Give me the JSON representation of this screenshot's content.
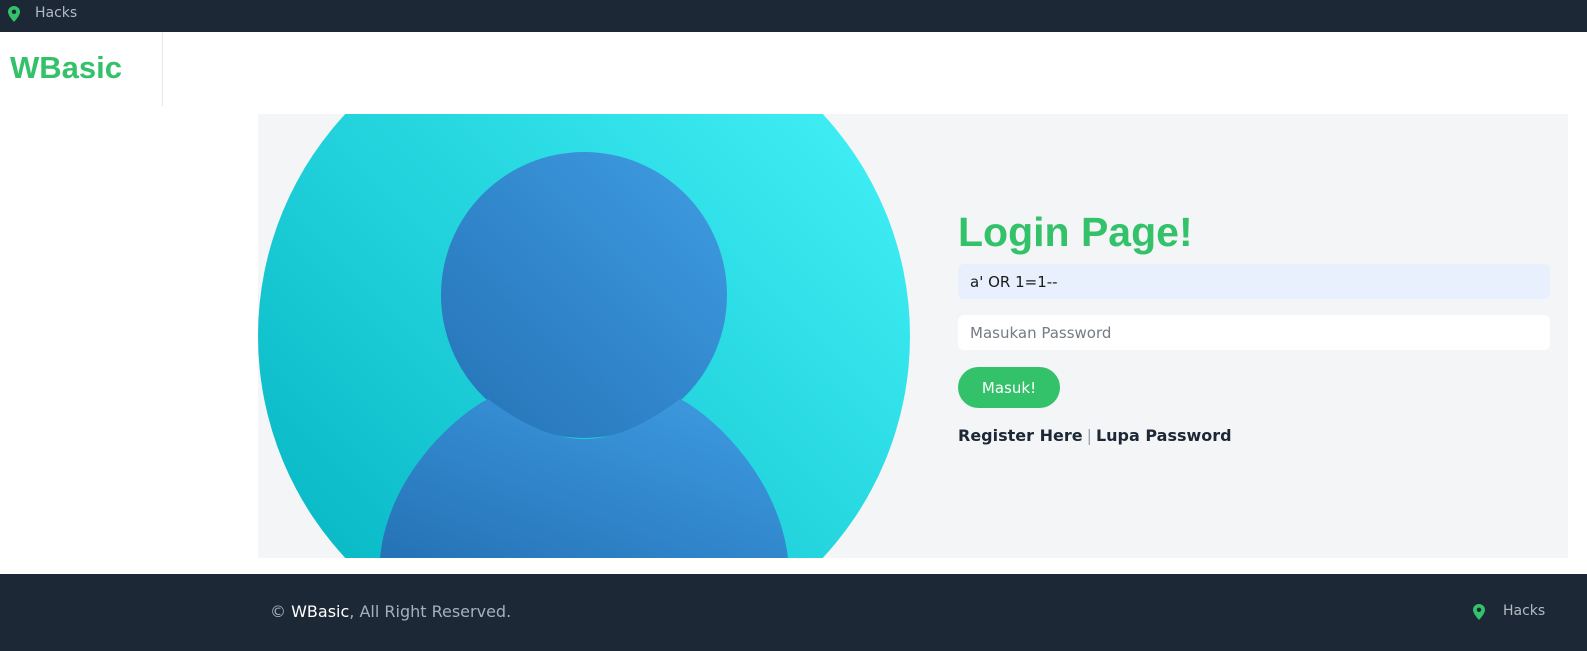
{
  "topbar": {
    "location_label": "Hacks",
    "icon": "map-pin-icon"
  },
  "header": {
    "brand": "WBasic"
  },
  "login": {
    "title": "Login Page!",
    "username_value": "a' OR 1=1--",
    "password_placeholder": "Masukan Password",
    "submit_label": "Masuk!",
    "register_link": "Register Here",
    "separator": "|",
    "forgot_link": "Lupa Password"
  },
  "footer": {
    "copyright_symbol": "©",
    "brand": "WBasic",
    "rights_text": ", All Right Reserved.",
    "location_label": "Hacks",
    "icon": "map-pin-icon"
  },
  "colors": {
    "accent": "#33c16a",
    "dark": "#1c2836",
    "hero_bg": "#f4f5f7",
    "avatar_circle_light": "#48f7fc",
    "avatar_circle_dark": "#00b1bf",
    "avatar_person": "#3a96dd"
  }
}
